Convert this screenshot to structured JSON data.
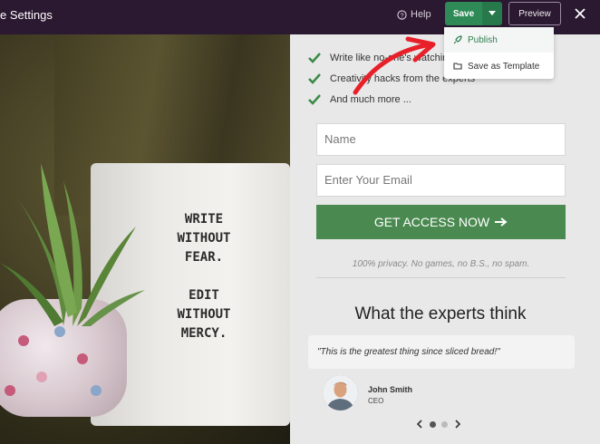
{
  "topbar": {
    "title": "e Settings",
    "help_label": "Help",
    "save_label": "Save",
    "preview_label": "Preview"
  },
  "save_menu": {
    "items": [
      {
        "label": "Publish",
        "icon": "rocket-icon"
      },
      {
        "label": "Save as Template",
        "icon": "folder-icon"
      }
    ]
  },
  "photo": {
    "box_text": "WRITE\nWITHOUT\nFEAR.\n\nEDIT\nWITHOUT\nMERCY."
  },
  "bullets": [
    "Write like no-one's watching",
    "Creativity hacks from the experts",
    "And much more ..."
  ],
  "form": {
    "name_placeholder": "Name",
    "email_placeholder": "Enter Your Email",
    "cta_label": "GET ACCESS NOW",
    "privacy_text": "100% privacy. No games, no B.S., no spam."
  },
  "testimonials": {
    "heading": "What the experts think",
    "quote": "\"This is the greatest thing since sliced bread!\"",
    "author_name": "John Smith",
    "author_role": "CEO",
    "slide_count": 2,
    "active_slide": 1
  },
  "colors": {
    "topbar_bg": "#2b1831",
    "save_green": "#2e8b57",
    "cta_green": "#4a8a50",
    "check_green": "#3a8a45",
    "annotation_red": "#e8202a"
  }
}
